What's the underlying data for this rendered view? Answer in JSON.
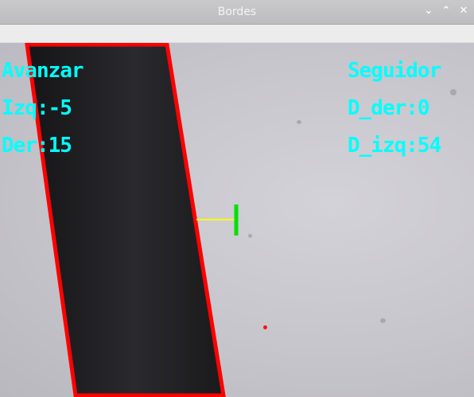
{
  "window": {
    "title": "Bordes"
  },
  "overlay": {
    "mode": "Avanzar",
    "izq": "Izq:-5",
    "der": "Der:15",
    "status": "Seguidor",
    "d_der": "D_der:0",
    "d_izq": "D_izq:54"
  },
  "colors": {
    "text": "#00ffff",
    "contour": "#ff0000",
    "distance_line": "#ffff00",
    "marker": "#00e000",
    "stripe": "#1b1b1d"
  },
  "icons": {
    "minimize": "chevron-down-icon",
    "maximize": "chevron-up-icon",
    "close": "close-icon"
  }
}
